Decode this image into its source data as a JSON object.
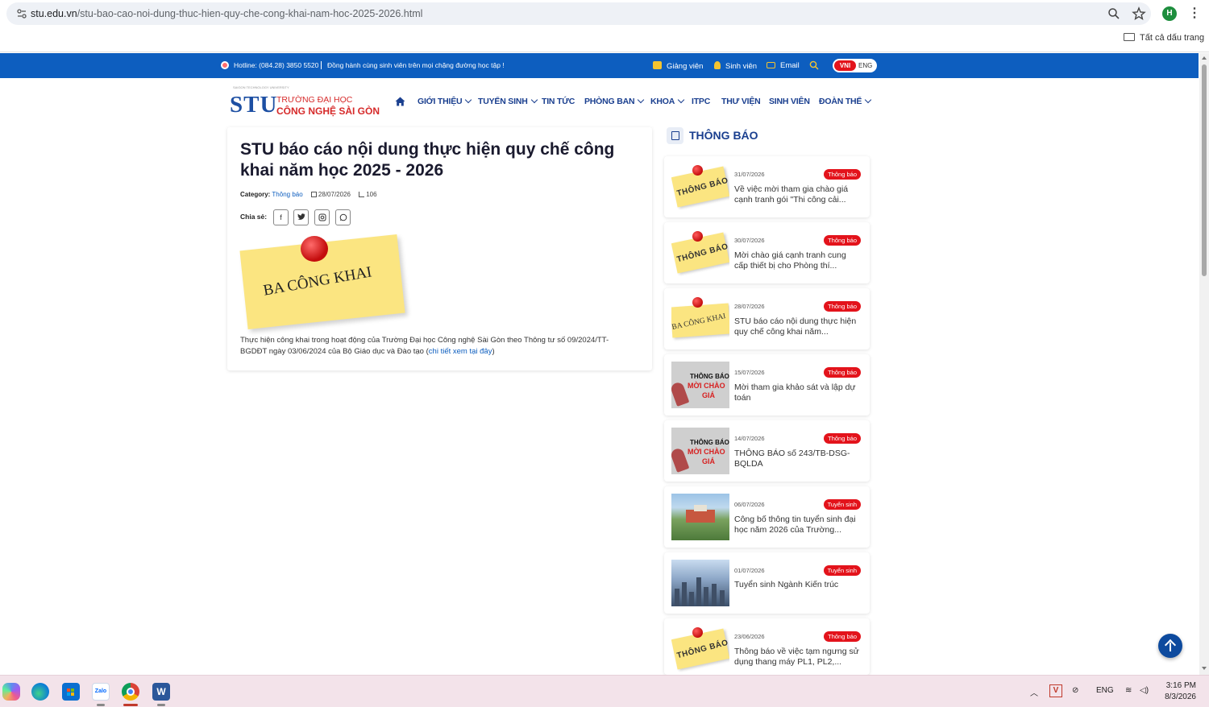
{
  "browser": {
    "url_domain": "stu.edu.vn",
    "url_path": "/stu-bao-cao-noi-dung-thuc-hien-quy-che-cong-khai-nam-hoc-2025-2026.html",
    "profile_initial": "H",
    "bookmarks_all": "Tất cả dấu trang"
  },
  "topbar": {
    "hotline": "Hotline: (084.28) 3850 5520",
    "tagline": "Đồng hành cùng sinh viên trên mọi chặng đường học tập !",
    "links": [
      "Giảng viên",
      "Sinh viên",
      "Email"
    ],
    "lang_active": "VNI",
    "lang_other": "ENG"
  },
  "logo": {
    "abbr": "STU",
    "line1": "TRƯỜNG ĐẠI HỌC",
    "line2": "CÔNG NGHỆ SÀI GÒN"
  },
  "nav": {
    "items": [
      "GIỚI THIỆU",
      "TUYỂN SINH",
      "TIN TỨC",
      "PHÒNG BAN",
      "KHOA",
      "ITPC",
      "THƯ VIỆN",
      "SINH VIÊN",
      "ĐOÀN THỂ"
    ]
  },
  "article": {
    "title": "STU báo cáo nội dung thực hiện quy chế công khai năm học 2025 - 2026",
    "category_label": "Category:",
    "category": "Thông báo",
    "date": "28/07/2026",
    "views": "106",
    "share_label": "Chia sẻ:",
    "share_buttons": [
      "f",
      "t",
      "ig",
      "wa"
    ],
    "image_text": "BA CÔNG KHAI",
    "body": "Thực hiện công khai trong hoạt động của Trường Đại học Công nghệ Sài Gòn theo Thông tư số 09/2024/TT-BGDĐT ngày 03/06/2024 của Bộ Giáo dục và Đào tạo (",
    "body_link": "chi tiết xem tại đây",
    "body_end": ")"
  },
  "sidebar": {
    "heading": "THÔNG BÁO",
    "items": [
      {
        "date": "31/07/2026",
        "badge": "Thông báo",
        "title": "Về việc mời tham gia chào giá cạnh tranh gói \"Thi công cải...",
        "thumb": "THÔNG BÁO"
      },
      {
        "date": "30/07/2026",
        "badge": "Thông báo",
        "title": "Mời chào giá cạnh tranh cung cấp thiết bị cho Phòng thí...",
        "thumb": "THÔNG BÁO"
      },
      {
        "date": "28/07/2026",
        "badge": "Thông báo",
        "title": "STU báo cáo nội dung thực hiện quy chế công khai năm...",
        "thumb": "BA CÔNG KHAI"
      },
      {
        "date": "15/07/2026",
        "badge": "Thông báo",
        "title": "Mời tham gia khảo sát và lập dự toán",
        "thumb": "THÔNG BÁO MỜI CHÀO GIÁ"
      },
      {
        "date": "14/07/2026",
        "badge": "Thông báo",
        "title": "THÔNG BÁO số 243/TB-DSG-BQLDA",
        "thumb": "THÔNG BÁO MỜI CHÀO GIÁ"
      },
      {
        "date": "06/07/2026",
        "badge": "Tuyển sinh",
        "title": "Công bố thông tin tuyển sinh đại học năm 2026 của Trường...",
        "thumb": "campus"
      },
      {
        "date": "01/07/2026",
        "badge": "Tuyển sinh",
        "title": "Tuyển sinh Ngành Kiến trúc",
        "thumb": "city"
      },
      {
        "date": "23/06/2026",
        "badge": "Thông báo",
        "title": "Thông báo về việc tạm ngưng sử dụng thang máy PL1, PL2,...",
        "thumb": "THÔNG BÁO"
      }
    ]
  },
  "taskbar": {
    "apps": [
      "copilot",
      "edge",
      "store",
      "zalo",
      "chrome",
      "word"
    ],
    "lang": "ENG",
    "time": "3:16 PM",
    "date": "8/3/2026"
  },
  "colors": {
    "brand_blue": "#0d5ebf",
    "nav_blue": "#1a3f8f",
    "badge_red": "#e3131b",
    "note_yellow": "#fbe581"
  }
}
